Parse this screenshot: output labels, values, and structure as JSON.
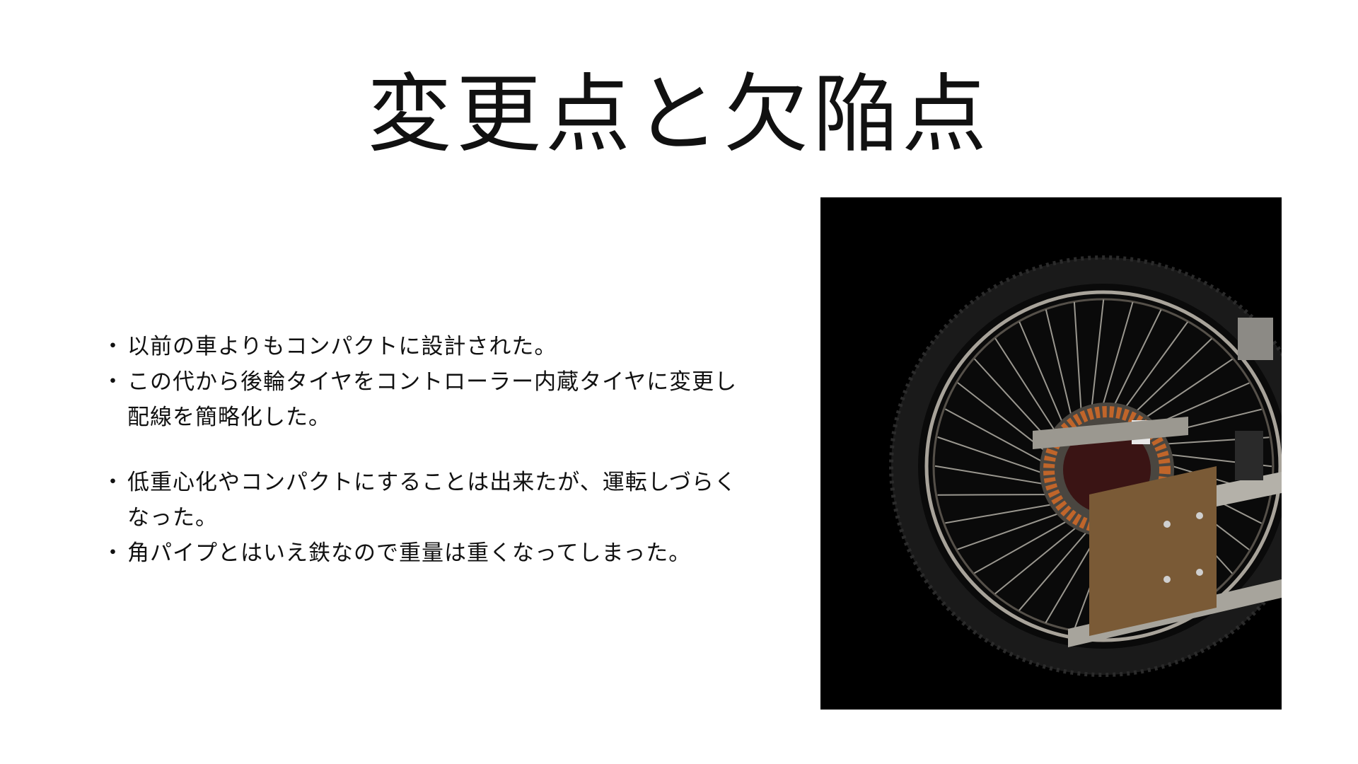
{
  "slide": {
    "title": "変更点と欠陥点",
    "bullet_marker": "・",
    "bullets": [
      {
        "text": "以前の車よりもコンパクトに設計された。"
      },
      {
        "text": "この代から後輪タイヤをコントローラー内蔵タイヤに変更し配線を簡略化した。"
      },
      {
        "text": "低重心化やコンパクトにすることは出来たが、運転しづらくなった。"
      },
      {
        "text": "角パイプとはいえ鉄なので重量は重くなってしまった。"
      }
    ]
  },
  "photo": {
    "subject": "rear-wheel-with-hub-motor-icon",
    "background_color": "#000000"
  }
}
